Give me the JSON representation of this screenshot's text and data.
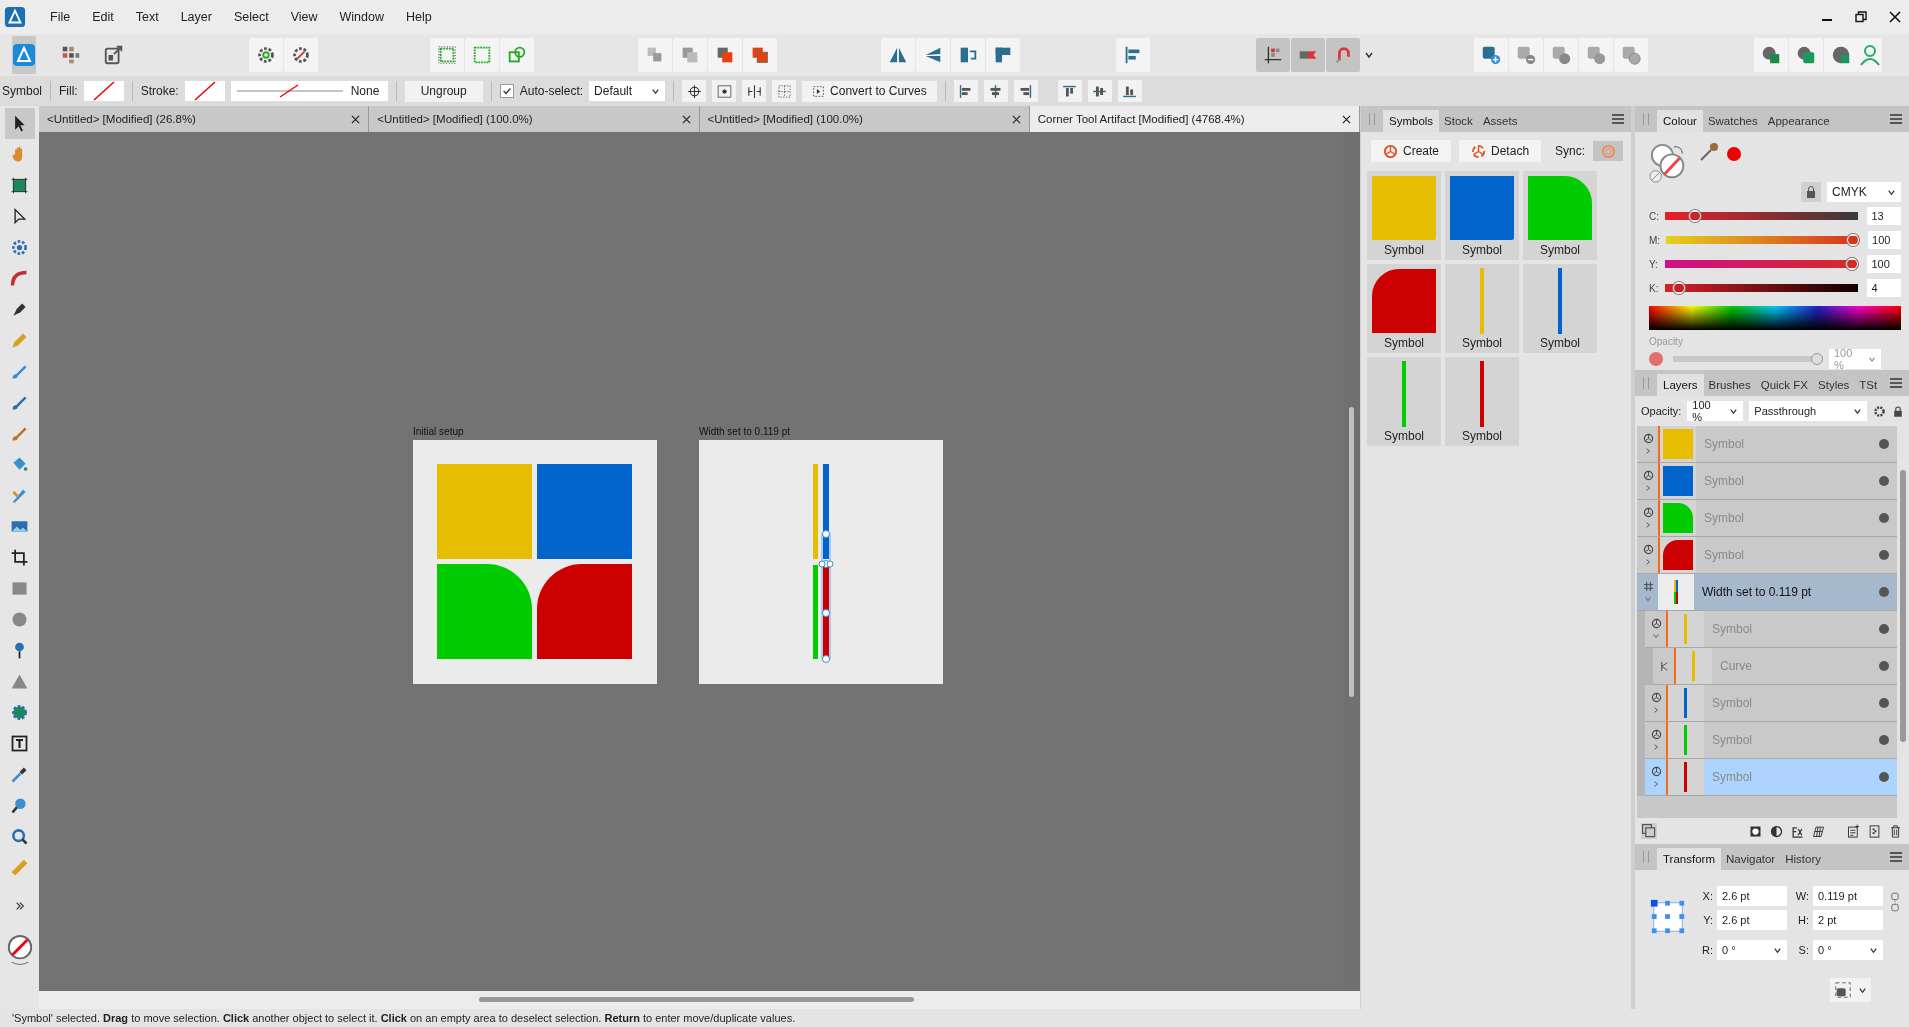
{
  "menu": [
    "File",
    "Edit",
    "Text",
    "Layer",
    "Select",
    "View",
    "Window",
    "Help"
  ],
  "context_bar": {
    "label": "Symbol",
    "fill_label": "Fill:",
    "stroke_label": "Stroke:",
    "stroke_style": "None",
    "ungroup": "Ungroup",
    "auto_select": {
      "label": "Auto-select:",
      "checked": true
    },
    "auto_select_mode": "Default",
    "convert": "Convert to Curves"
  },
  "document_tabs": [
    {
      "title": "<Untitled> [Modified] (26.8%)",
      "selected": false
    },
    {
      "title": "<Untitled> [Modified] (100.0%)",
      "selected": false
    },
    {
      "title": "<Untitled> [Modified] (100.0%)",
      "selected": false
    },
    {
      "title": "Corner Tool Artifact [Modified] (4768.4%)",
      "selected": true
    }
  ],
  "canvas": {
    "artboards": [
      {
        "label": "Initial setup",
        "kind": "quad"
      },
      {
        "label": "Width set to 0.119 pt",
        "kind": "lines"
      }
    ]
  },
  "symbols_panel": {
    "tabs": [
      {
        "label": "Symbols",
        "selected": true
      },
      {
        "label": "Stock",
        "selected": false
      },
      {
        "label": "Assets",
        "selected": false
      }
    ],
    "create": "Create",
    "detach": "Detach",
    "sync_label": "Sync:",
    "items": [
      {
        "label": "Symbol",
        "kind": "square",
        "color": "#e6bd00"
      },
      {
        "label": "Symbol",
        "kind": "square",
        "color": "#0064cc"
      },
      {
        "label": "Symbol",
        "kind": "round-right",
        "color": "#00cc00"
      },
      {
        "label": "Symbol",
        "kind": "round-left",
        "color": "#cc0000"
      },
      {
        "label": "Symbol",
        "kind": "line",
        "color": "#e6bd00"
      },
      {
        "label": "Symbol",
        "kind": "line",
        "color": "#0064cc"
      },
      {
        "label": "Symbol",
        "kind": "line",
        "color": "#00cc00"
      },
      {
        "label": "Symbol",
        "kind": "line",
        "color": "#cc0000"
      }
    ]
  },
  "colour_panel": {
    "tabs": [
      {
        "label": "Colour",
        "selected": true
      },
      {
        "label": "Swatches",
        "selected": false
      },
      {
        "label": "Appearance",
        "selected": false
      }
    ],
    "model": "CMYK",
    "sliders": [
      {
        "label": "C:",
        "kind": "c",
        "level": 0.13,
        "value": "13"
      },
      {
        "label": "M:",
        "kind": "m",
        "level": 1,
        "value": "100"
      },
      {
        "label": "Y:",
        "kind": "y",
        "level": 1,
        "value": "100"
      },
      {
        "label": "K:",
        "kind": "k",
        "level": 0.04,
        "value": "4"
      }
    ],
    "opacity_label": "Opacity",
    "opacity": {
      "level": 1,
      "value": "100 %"
    }
  },
  "layers_panel": {
    "tabs": [
      {
        "label": "Layers",
        "selected": true
      },
      {
        "label": "Brushes",
        "selected": false
      },
      {
        "label": "Quick FX",
        "selected": false
      },
      {
        "label": "Styles",
        "selected": false
      },
      {
        "label": "TSt",
        "selected": false
      }
    ],
    "opacity_label": "Opacity:",
    "opacity_value": "100 %",
    "blend_mode": "Passthrough",
    "layers": [
      {
        "name": "Symbol",
        "kind": "symbol",
        "selected": false,
        "expanded": false,
        "thumb": {
          "kind": "square",
          "color": "#e6bd00"
        }
      },
      {
        "name": "Symbol",
        "kind": "symbol",
        "selected": false,
        "expanded": false,
        "thumb": {
          "kind": "square",
          "color": "#0064cc"
        }
      },
      {
        "name": "Symbol",
        "kind": "symbol",
        "selected": false,
        "expanded": false,
        "thumb": {
          "kind": "round-right",
          "color": "#00cc00"
        }
      },
      {
        "name": "Symbol",
        "kind": "symbol",
        "selected": false,
        "expanded": false,
        "thumb": {
          "kind": "round-left",
          "color": "#cc0000"
        }
      },
      {
        "name": "Width set to 0.119 pt",
        "kind": "artboard",
        "selected": false,
        "expanded": true,
        "thumb": {
          "kind": "board",
          "color": "#0064cc"
        },
        "children": [
          {
            "name": "Symbol",
            "kind": "symbol",
            "selected": false,
            "expanded": true,
            "thumb": {
              "kind": "line",
              "color": "#e6bd00"
            },
            "children": [
              {
                "name": "Curve",
                "kind": "curve",
                "selected": false,
                "thumb": {
                  "kind": "line",
                  "color": "#e6bd00"
                }
              }
            ]
          },
          {
            "name": "Symbol",
            "kind": "symbol",
            "selected": false,
            "expanded": false,
            "thumb": {
              "kind": "line",
              "color": "#0064cc"
            }
          },
          {
            "name": "Symbol",
            "kind": "symbol",
            "selected": false,
            "expanded": false,
            "thumb": {
              "kind": "line",
              "color": "#00cc00"
            }
          },
          {
            "name": "Symbol",
            "kind": "symbol",
            "selected": true,
            "expanded": false,
            "thumb": {
              "kind": "line",
              "color": "#cc0000"
            }
          }
        ]
      }
    ]
  },
  "transform_panel": {
    "tabs": [
      {
        "label": "Transform",
        "selected": true
      },
      {
        "label": "Navigator",
        "selected": false
      },
      {
        "label": "History",
        "selected": false
      }
    ],
    "fields": [
      {
        "label": "X:",
        "value": "2.6 pt",
        "kind": "text"
      },
      {
        "label": "W:",
        "value": "0.119 pt",
        "kind": "text"
      },
      {
        "label": "Y:",
        "value": "2.6 pt",
        "kind": "text"
      },
      {
        "label": "H:",
        "value": "2 pt",
        "kind": "text"
      },
      {
        "label": "R:",
        "value": "0 °",
        "kind": "select"
      },
      {
        "label": "S:",
        "value": "0 °",
        "kind": "select"
      }
    ]
  },
  "status_bar": "'Symbol' selected. **Drag** to move selection. **Click** another object to select it. **Click** on an empty area to deselect selection. **Return** to enter move/duplicate values."
}
